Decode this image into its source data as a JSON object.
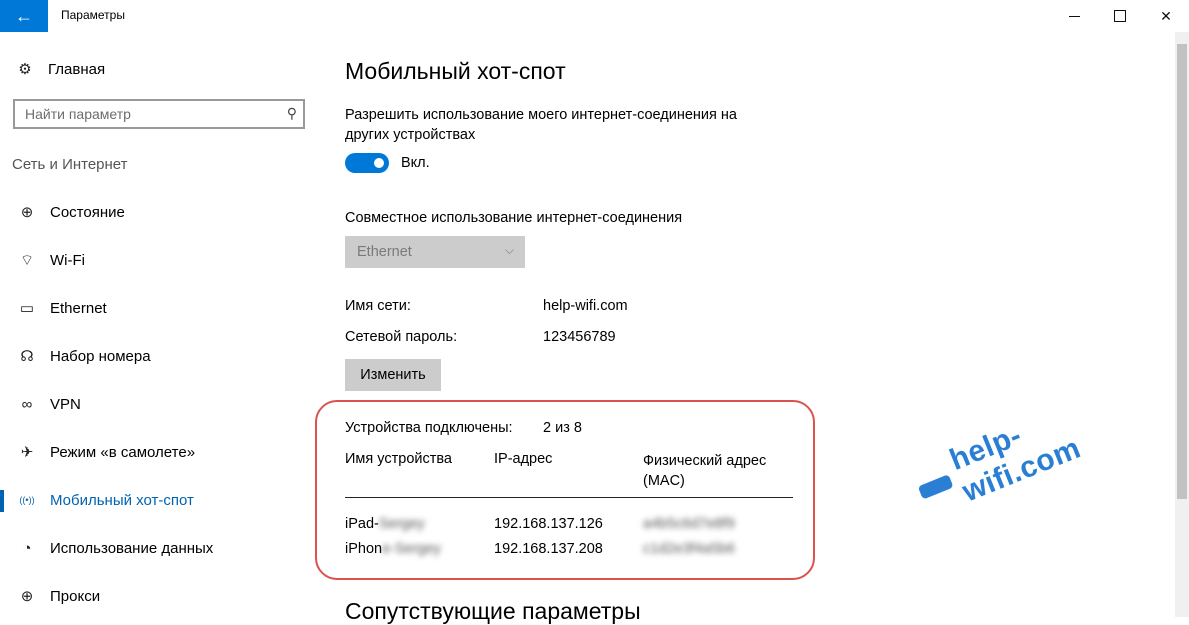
{
  "window": {
    "title": "Параметры",
    "back_icon": "←",
    "minimize_icon": "minimize-icon",
    "maximize_icon": "maximize-icon",
    "close_icon": "✕"
  },
  "sidebar": {
    "home_label": "Главная",
    "search_placeholder": "Найти параметр",
    "section_label": "Сеть и Интернет",
    "items": [
      {
        "label": "Состояние",
        "icon": "status-icon",
        "glyph": "⊕",
        "active": false
      },
      {
        "label": "Wi-Fi",
        "icon": "wifi-icon",
        "glyph": "⌔",
        "active": false
      },
      {
        "label": "Ethernet",
        "icon": "ethernet-icon",
        "glyph": "▭",
        "active": false
      },
      {
        "label": "Набор номера",
        "icon": "dialup-icon",
        "glyph": "☊",
        "active": false
      },
      {
        "label": "VPN",
        "icon": "vpn-icon",
        "glyph": "∞",
        "active": false
      },
      {
        "label": "Режим «в самолете»",
        "icon": "airplane-icon",
        "glyph": "✈",
        "active": false
      },
      {
        "label": "Мобильный хот-спот",
        "icon": "hotspot-icon",
        "glyph": "((•))",
        "active": true
      },
      {
        "label": "Использование данных",
        "icon": "data-usage-icon",
        "glyph": "◔",
        "active": false
      },
      {
        "label": "Прокси",
        "icon": "proxy-icon",
        "glyph": "⊕",
        "active": false
      }
    ]
  },
  "main": {
    "title": "Мобильный хот-спот",
    "share_description": "Разрешить использование моего интернет-соединения на других устройствах",
    "toggle_state": "Вкл.",
    "share_from_label": "Совместное использование интернет-соединения",
    "share_from_value": "Ethernet",
    "network_name_label": "Имя сети:",
    "network_name_value": "help-wifi.com",
    "password_label": "Сетевой пароль:",
    "password_value": "123456789",
    "edit_button": "Изменить",
    "devices_connected_label": "Устройства подключены:",
    "devices_connected_value": "2 из 8",
    "table_headers": {
      "device_name": "Имя устройства",
      "ip": "IP-адрес",
      "mac": "Физический адрес (MAC)"
    },
    "devices": [
      {
        "name": "iPad-",
        "name_hidden": "Sergey",
        "ip": "192.168.137.126",
        "mac_hidden": "a4b5c6d7e8f9"
      },
      {
        "name": "iPhon",
        "name_hidden": "e-Sergey",
        "ip": "192.168.137.208",
        "mac_hidden": "c1d2e3f4a5b6"
      }
    ],
    "related_title": "Сопутствующие параметры"
  },
  "watermark": "help-wifi.com",
  "colors": {
    "accent": "#0078d7",
    "active_nav": "#0063b1",
    "highlight_box": "#d9534f",
    "watermark": "#2a7fd4"
  }
}
